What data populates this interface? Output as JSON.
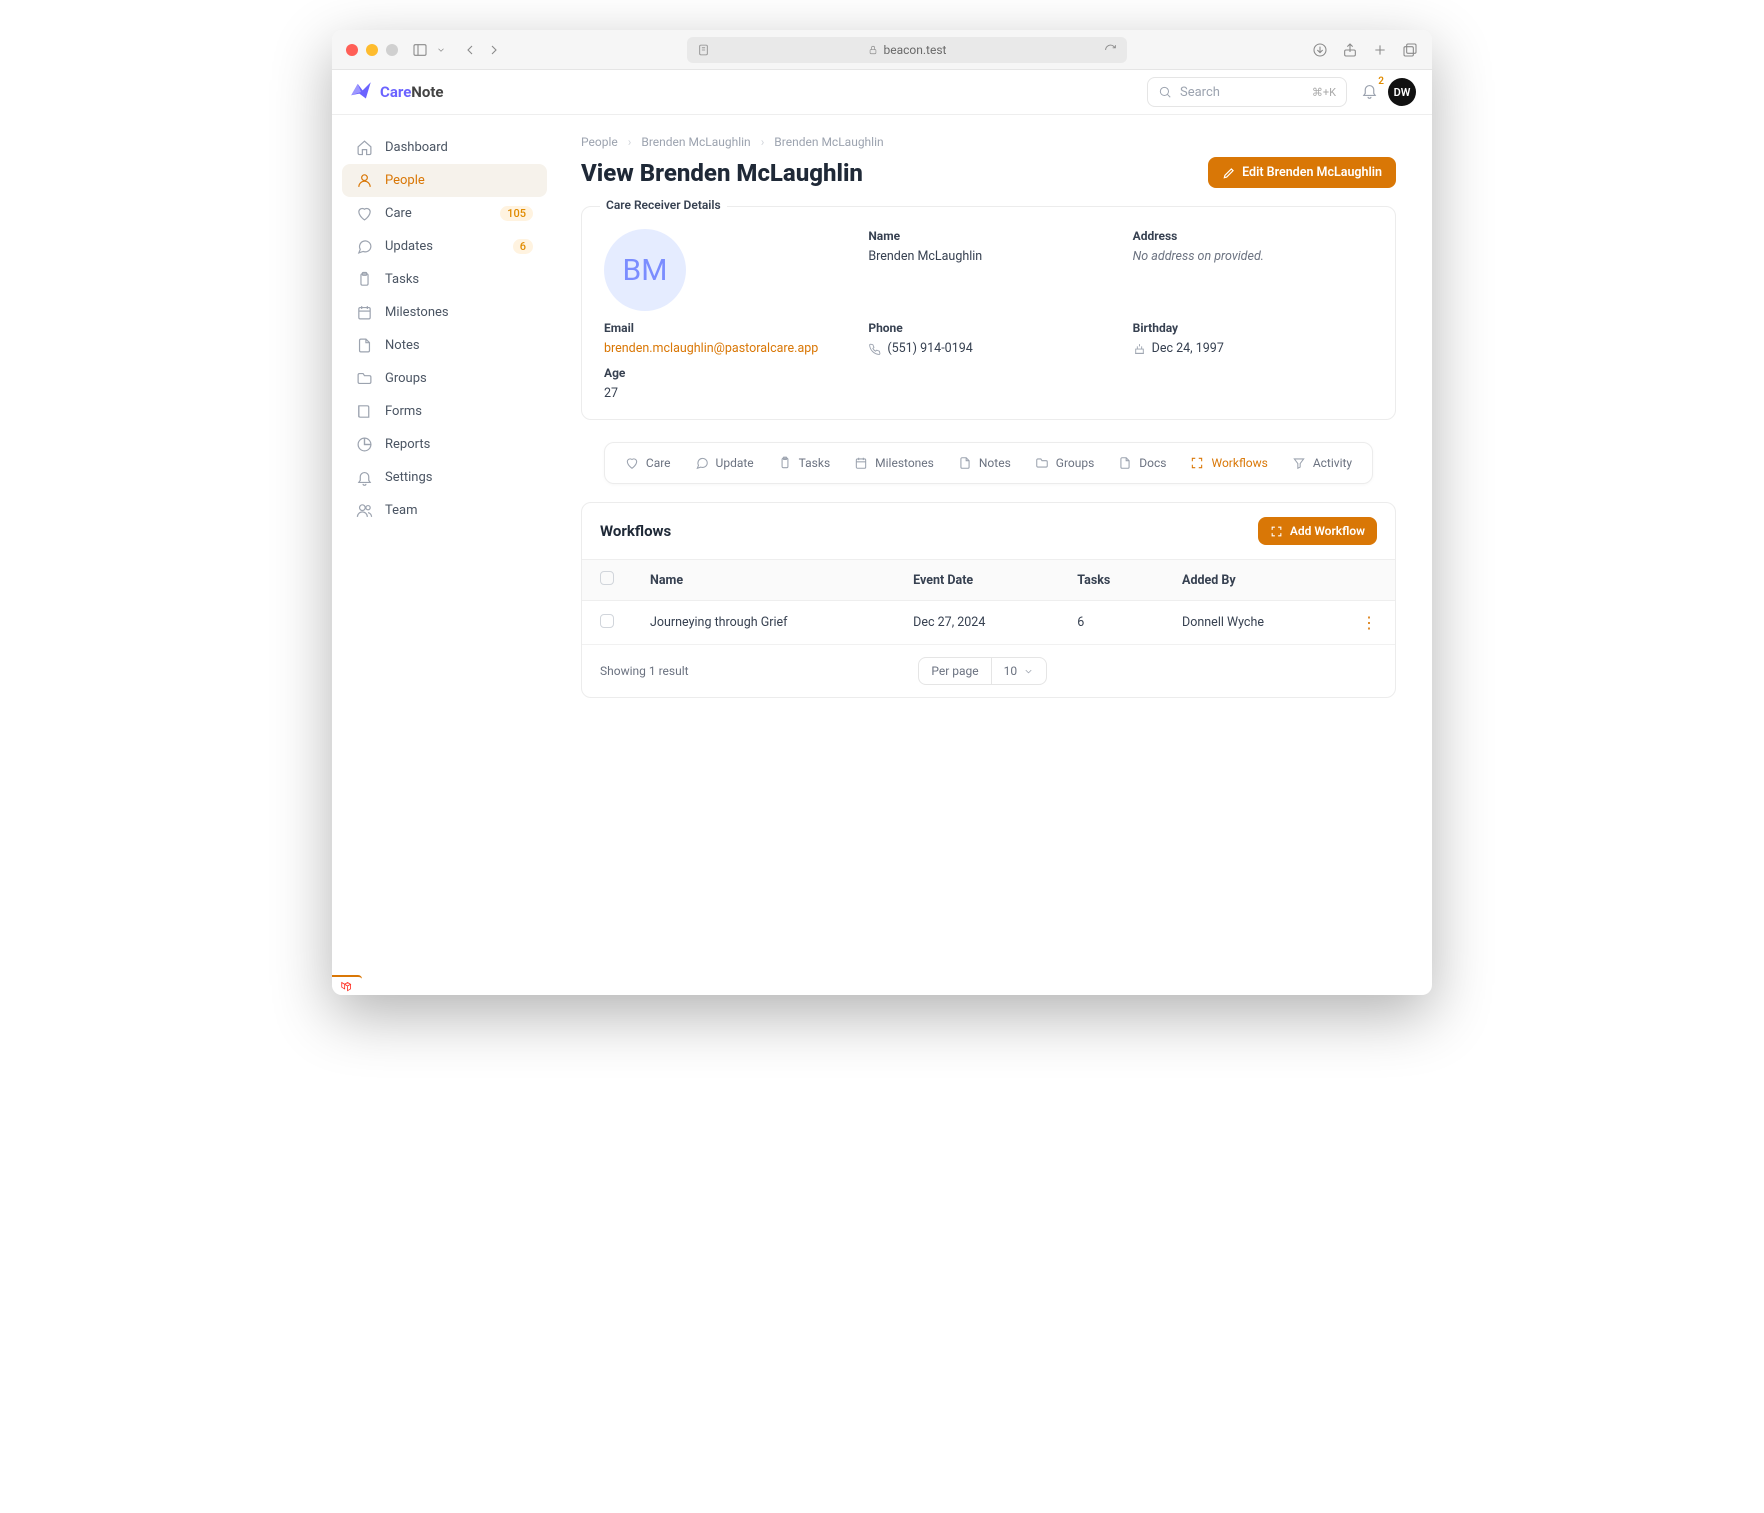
{
  "browser": {
    "url": "beacon.test"
  },
  "brand": {
    "name_a": "Care",
    "name_b": "Note"
  },
  "search": {
    "placeholder": "Search",
    "shortcut": "⌘+K"
  },
  "notifications": {
    "count": "2"
  },
  "user": {
    "initials": "DW"
  },
  "sidebar": {
    "items": [
      {
        "label": "Dashboard",
        "icon": "home"
      },
      {
        "label": "People",
        "icon": "user",
        "active": true
      },
      {
        "label": "Care",
        "icon": "heart",
        "badge": "105"
      },
      {
        "label": "Updates",
        "icon": "chat",
        "badge": "6"
      },
      {
        "label": "Tasks",
        "icon": "clipboard"
      },
      {
        "label": "Milestones",
        "icon": "calendar"
      },
      {
        "label": "Notes",
        "icon": "file"
      },
      {
        "label": "Groups",
        "icon": "folder"
      },
      {
        "label": "Forms",
        "icon": "book"
      },
      {
        "label": "Reports",
        "icon": "pie"
      },
      {
        "label": "Settings",
        "icon": "bell"
      },
      {
        "label": "Team",
        "icon": "users"
      }
    ]
  },
  "breadcrumbs": [
    "People",
    "Brenden McLaughlin",
    "Brenden McLaughlin"
  ],
  "page": {
    "title": "View Brenden McLaughlin",
    "edit_label": "Edit Brenden McLaughlin"
  },
  "details": {
    "legend": "Care Receiver Details",
    "avatar_initials": "BM",
    "name_label": "Name",
    "name": "Brenden McLaughlin",
    "address_label": "Address",
    "address": "No address on provided.",
    "email_label": "Email",
    "email": "brenden.mclaughlin@pastoralcare.app",
    "phone_label": "Phone",
    "phone": "(551) 914-0194",
    "birthday_label": "Birthday",
    "birthday": "Dec 24, 1997",
    "age_label": "Age",
    "age": "27"
  },
  "tabs": [
    {
      "label": "Care",
      "icon": "heart"
    },
    {
      "label": "Update",
      "icon": "chat"
    },
    {
      "label": "Tasks",
      "icon": "clipboard"
    },
    {
      "label": "Milestones",
      "icon": "calendar"
    },
    {
      "label": "Notes",
      "icon": "file"
    },
    {
      "label": "Groups",
      "icon": "folder"
    },
    {
      "label": "Docs",
      "icon": "file"
    },
    {
      "label": "Workflows",
      "icon": "workflow",
      "active": true
    },
    {
      "label": "Activity",
      "icon": "filter"
    }
  ],
  "workflows": {
    "title": "Workflows",
    "add_label": "Add Workflow",
    "columns": [
      "Name",
      "Event Date",
      "Tasks",
      "Added By"
    ],
    "rows": [
      {
        "name": "Journeying through Grief",
        "event_date": "Dec 27, 2024",
        "tasks": "6",
        "added_by": "Donnell Wyche"
      }
    ],
    "result_text": "Showing 1 result",
    "per_page_label": "Per page",
    "per_page_value": "10"
  }
}
